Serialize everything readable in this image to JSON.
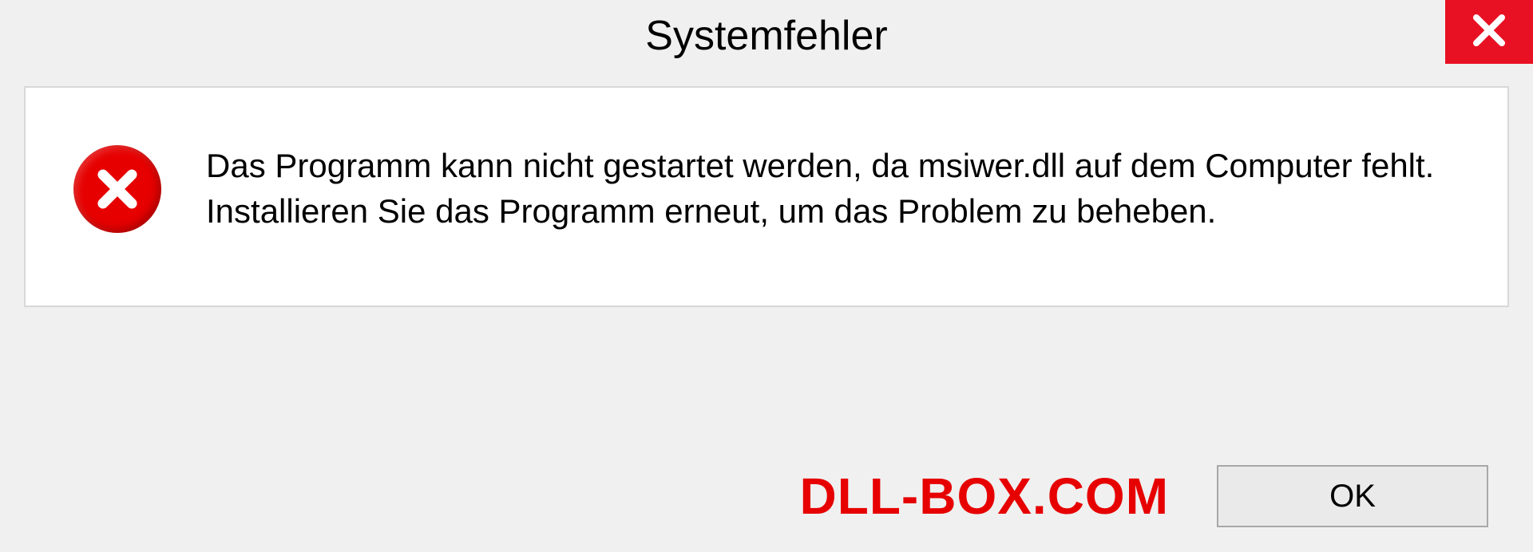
{
  "dialog": {
    "title": "Systemfehler",
    "message": "Das Programm kann nicht gestartet werden, da msiwer.dll auf dem Computer fehlt. Installieren Sie das Programm erneut, um das Problem zu beheben.",
    "ok_label": "OK"
  },
  "watermark": "DLL-BOX.COM"
}
